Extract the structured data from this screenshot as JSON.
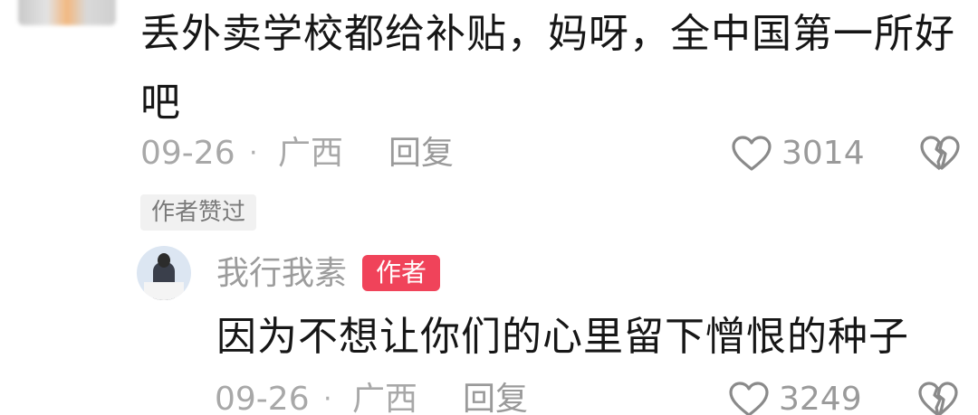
{
  "comment": {
    "text": "丢外卖学校都给补贴，妈呀，全中国第一所好吧",
    "date": "09-26",
    "separator": "·",
    "location": "广西",
    "reply_label": "回复",
    "like_count": "3014",
    "author_liked_label": "作者赞过"
  },
  "reply": {
    "username": "我行我素",
    "author_badge": "作者",
    "text": "因为不想让你们的心里留下憎恨的种子",
    "date": "09-26",
    "separator": "·",
    "location": "广西",
    "reply_label": "回复",
    "like_count": "3249"
  },
  "colors": {
    "badge_red": "#f0435a",
    "meta_gray": "#a8a8a8",
    "text_dark": "#161616"
  },
  "icons": {
    "like": "heart-outline-icon",
    "dislike": "broken-heart-icon"
  }
}
